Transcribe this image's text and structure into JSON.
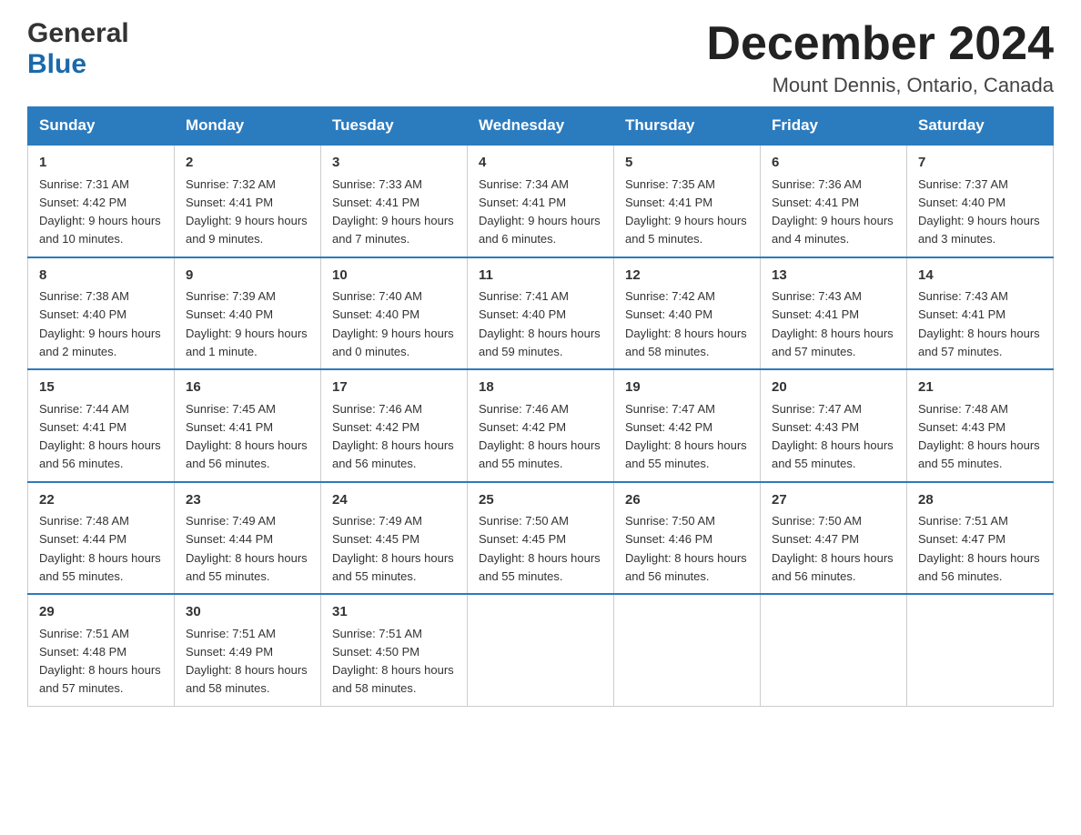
{
  "header": {
    "logo_general": "General",
    "logo_blue": "Blue",
    "month_title": "December 2024",
    "location": "Mount Dennis, Ontario, Canada"
  },
  "days_of_week": [
    "Sunday",
    "Monday",
    "Tuesday",
    "Wednesday",
    "Thursday",
    "Friday",
    "Saturday"
  ],
  "weeks": [
    [
      {
        "day": "1",
        "sunrise": "7:31 AM",
        "sunset": "4:42 PM",
        "daylight": "9 hours and 10 minutes."
      },
      {
        "day": "2",
        "sunrise": "7:32 AM",
        "sunset": "4:41 PM",
        "daylight": "9 hours and 9 minutes."
      },
      {
        "day": "3",
        "sunrise": "7:33 AM",
        "sunset": "4:41 PM",
        "daylight": "9 hours and 7 minutes."
      },
      {
        "day": "4",
        "sunrise": "7:34 AM",
        "sunset": "4:41 PM",
        "daylight": "9 hours and 6 minutes."
      },
      {
        "day": "5",
        "sunrise": "7:35 AM",
        "sunset": "4:41 PM",
        "daylight": "9 hours and 5 minutes."
      },
      {
        "day": "6",
        "sunrise": "7:36 AM",
        "sunset": "4:41 PM",
        "daylight": "9 hours and 4 minutes."
      },
      {
        "day": "7",
        "sunrise": "7:37 AM",
        "sunset": "4:40 PM",
        "daylight": "9 hours and 3 minutes."
      }
    ],
    [
      {
        "day": "8",
        "sunrise": "7:38 AM",
        "sunset": "4:40 PM",
        "daylight": "9 hours and 2 minutes."
      },
      {
        "day": "9",
        "sunrise": "7:39 AM",
        "sunset": "4:40 PM",
        "daylight": "9 hours and 1 minute."
      },
      {
        "day": "10",
        "sunrise": "7:40 AM",
        "sunset": "4:40 PM",
        "daylight": "9 hours and 0 minutes."
      },
      {
        "day": "11",
        "sunrise": "7:41 AM",
        "sunset": "4:40 PM",
        "daylight": "8 hours and 59 minutes."
      },
      {
        "day": "12",
        "sunrise": "7:42 AM",
        "sunset": "4:40 PM",
        "daylight": "8 hours and 58 minutes."
      },
      {
        "day": "13",
        "sunrise": "7:43 AM",
        "sunset": "4:41 PM",
        "daylight": "8 hours and 57 minutes."
      },
      {
        "day": "14",
        "sunrise": "7:43 AM",
        "sunset": "4:41 PM",
        "daylight": "8 hours and 57 minutes."
      }
    ],
    [
      {
        "day": "15",
        "sunrise": "7:44 AM",
        "sunset": "4:41 PM",
        "daylight": "8 hours and 56 minutes."
      },
      {
        "day": "16",
        "sunrise": "7:45 AM",
        "sunset": "4:41 PM",
        "daylight": "8 hours and 56 minutes."
      },
      {
        "day": "17",
        "sunrise": "7:46 AM",
        "sunset": "4:42 PM",
        "daylight": "8 hours and 56 minutes."
      },
      {
        "day": "18",
        "sunrise": "7:46 AM",
        "sunset": "4:42 PM",
        "daylight": "8 hours and 55 minutes."
      },
      {
        "day": "19",
        "sunrise": "7:47 AM",
        "sunset": "4:42 PM",
        "daylight": "8 hours and 55 minutes."
      },
      {
        "day": "20",
        "sunrise": "7:47 AM",
        "sunset": "4:43 PM",
        "daylight": "8 hours and 55 minutes."
      },
      {
        "day": "21",
        "sunrise": "7:48 AM",
        "sunset": "4:43 PM",
        "daylight": "8 hours and 55 minutes."
      }
    ],
    [
      {
        "day": "22",
        "sunrise": "7:48 AM",
        "sunset": "4:44 PM",
        "daylight": "8 hours and 55 minutes."
      },
      {
        "day": "23",
        "sunrise": "7:49 AM",
        "sunset": "4:44 PM",
        "daylight": "8 hours and 55 minutes."
      },
      {
        "day": "24",
        "sunrise": "7:49 AM",
        "sunset": "4:45 PM",
        "daylight": "8 hours and 55 minutes."
      },
      {
        "day": "25",
        "sunrise": "7:50 AM",
        "sunset": "4:45 PM",
        "daylight": "8 hours and 55 minutes."
      },
      {
        "day": "26",
        "sunrise": "7:50 AM",
        "sunset": "4:46 PM",
        "daylight": "8 hours and 56 minutes."
      },
      {
        "day": "27",
        "sunrise": "7:50 AM",
        "sunset": "4:47 PM",
        "daylight": "8 hours and 56 minutes."
      },
      {
        "day": "28",
        "sunrise": "7:51 AM",
        "sunset": "4:47 PM",
        "daylight": "8 hours and 56 minutes."
      }
    ],
    [
      {
        "day": "29",
        "sunrise": "7:51 AM",
        "sunset": "4:48 PM",
        "daylight": "8 hours and 57 minutes."
      },
      {
        "day": "30",
        "sunrise": "7:51 AM",
        "sunset": "4:49 PM",
        "daylight": "8 hours and 58 minutes."
      },
      {
        "day": "31",
        "sunrise": "7:51 AM",
        "sunset": "4:50 PM",
        "daylight": "8 hours and 58 minutes."
      },
      null,
      null,
      null,
      null
    ]
  ],
  "labels": {
    "sunrise": "Sunrise:",
    "sunset": "Sunset:",
    "daylight": "Daylight:"
  }
}
